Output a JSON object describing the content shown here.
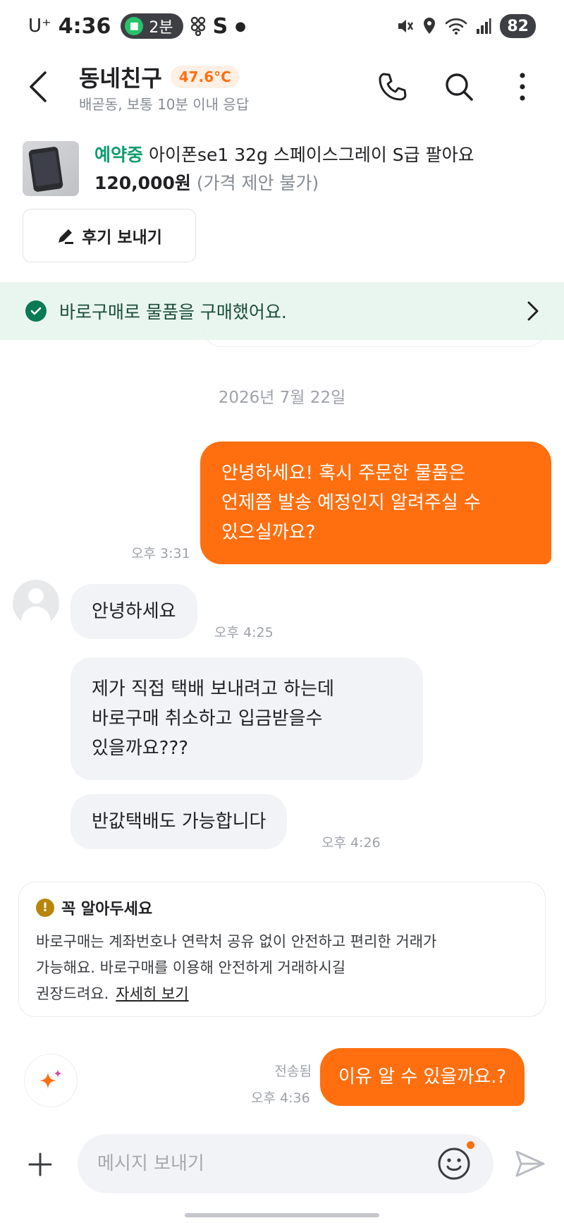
{
  "status_bar": {
    "carrier": "U⁺",
    "time": "4:36",
    "transit_label": "2분",
    "app_letter": "S",
    "battery": "82"
  },
  "header": {
    "title": "동네친구",
    "temperature": "47.6°C",
    "subtitle": "배곧동, 보통 10분 이내 응답"
  },
  "product": {
    "status": "예약중",
    "title": "아이폰se1 32g 스페이스그레이 S급 팔아요",
    "price": "120,000원",
    "price_note": "(가격 제안 불가)"
  },
  "review_button": {
    "label": "후기 보내기"
  },
  "banner": {
    "text": "바로구매로 물품을 구매했어요."
  },
  "date_separator": "2026년 7월 22일",
  "messages": [
    {
      "from": "me",
      "lines": [
        "안녕하세요! 혹시 주문한 물품은",
        "언제쯤 발송 예정인지 알려주실 수",
        "있으실까요?"
      ],
      "time": "오후 3:31"
    },
    {
      "from": "other",
      "lines": [
        "안녕하세요"
      ],
      "time": "오후 4:25"
    },
    {
      "from": "other",
      "lines": [
        "제가 직접 택배 보내려고 하는데",
        "바로구매 취소하고 입금받을수",
        "있을까요???"
      ],
      "time": ""
    },
    {
      "from": "other",
      "lines": [
        "반값택배도 가능합니다"
      ],
      "time": "오후 4:26"
    },
    {
      "from": "me",
      "lines": [
        "이유 알 수 있을까요.?"
      ],
      "time": "오후 4:36",
      "status": "전송됨"
    }
  ],
  "notice": {
    "title": "꼭 알아두세요",
    "lines": [
      "바로구매는 계좌번호나 연락처 공유 없이 안전하고 편리한 거래가",
      "가능해요. 바로구매를 이용해 안전하게 거래하시길",
      "권장드려요."
    ],
    "link": "자세히 보기"
  },
  "input": {
    "placeholder": "메시지 보내기"
  },
  "colors": {
    "accent": "#ff6f0f",
    "success": "#0a7a55",
    "banner_bg": "#e9f6f0"
  },
  "icons": [
    "back-icon",
    "phone-icon",
    "search-icon",
    "more-icon",
    "edit-icon",
    "check-circle-icon",
    "chevron-right-icon",
    "avatar-icon",
    "warning-icon",
    "sparkle-icon",
    "plus-icon",
    "emoji-icon",
    "send-icon"
  ]
}
